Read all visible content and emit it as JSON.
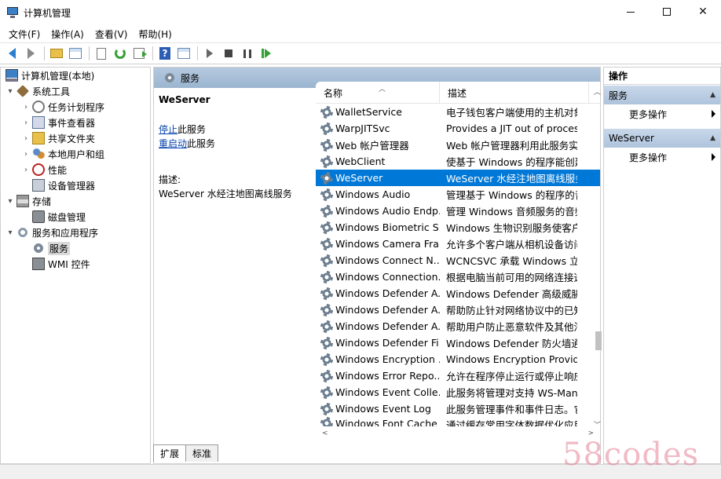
{
  "window": {
    "title": "计算机管理",
    "controls": {
      "minimize": "—",
      "maximize": "☐",
      "close": "✕"
    }
  },
  "menu": [
    "文件(F)",
    "操作(A)",
    "查看(V)",
    "帮助(H)"
  ],
  "toolbar": {
    "icons": [
      "back-icon",
      "forward-icon",
      "up-folder-icon",
      "show-hide-tree-icon",
      "properties-icon",
      "refresh-icon",
      "export-list-icon",
      "help-icon",
      "show-hide-action-pane-icon",
      "start-service-icon",
      "stop-service-icon",
      "pause-service-icon",
      "restart-service-icon"
    ]
  },
  "tree": {
    "root": "计算机管理(本地)",
    "items": [
      {
        "label": "系统工具",
        "level": 1,
        "expanded": true
      },
      {
        "label": "任务计划程序",
        "level": 2,
        "has_children": true
      },
      {
        "label": "事件查看器",
        "level": 2,
        "has_children": true
      },
      {
        "label": "共享文件夹",
        "level": 2,
        "has_children": true
      },
      {
        "label": "本地用户和组",
        "level": 2,
        "has_children": true
      },
      {
        "label": "性能",
        "level": 2,
        "has_children": true
      },
      {
        "label": "设备管理器",
        "level": 2,
        "has_children": false
      },
      {
        "label": "存储",
        "level": 1,
        "expanded": true
      },
      {
        "label": "磁盘管理",
        "level": 2,
        "has_children": false
      },
      {
        "label": "服务和应用程序",
        "level": 1,
        "expanded": true
      },
      {
        "label": "服务",
        "level": 2,
        "selected": true
      },
      {
        "label": "WMI 控件",
        "level": 2
      }
    ]
  },
  "middle": {
    "header": "服务",
    "details": {
      "service_name": "WeServer",
      "stop_link": "停止",
      "stop_suffix": "此服务",
      "restart_link": "重启动",
      "restart_suffix": "此服务",
      "desc_label": "描述:",
      "desc_text": "WeServer 水经注地图离线服务"
    },
    "columns": {
      "name": "名称",
      "desc": "描述"
    },
    "rows": [
      {
        "name": "WalletService",
        "desc": "电子钱包客户端使用的主机对象"
      },
      {
        "name": "WarpJITSvc",
        "desc": "Provides a JIT out of process"
      },
      {
        "name": "Web 帐户管理器",
        "desc": "Web 帐户管理器利用此服务实现"
      },
      {
        "name": "WebClient",
        "desc": "使基于 Windows 的程序能创建、"
      },
      {
        "name": "WeServer",
        "desc": "WeServer 水经注地图离线服务",
        "selected": true
      },
      {
        "name": "Windows Audio",
        "desc": "管理基于 Windows 的程序的音频"
      },
      {
        "name": "Windows Audio Endp...",
        "desc": "管理 Windows 音频服务的音频设"
      },
      {
        "name": "Windows Biometric S...",
        "desc": "Windows 生物识别服务使客户端"
      },
      {
        "name": "Windows Camera Fra...",
        "desc": "允许多个客户端从相机设备访问视"
      },
      {
        "name": "Windows Connect N...",
        "desc": "WCNCSVC 承载 Windows 立即连"
      },
      {
        "name": "Windows Connection...",
        "desc": "根据电脑当前可用的网络连接选项"
      },
      {
        "name": "Windows Defender A...",
        "desc": "Windows Defender 高级威胁防护"
      },
      {
        "name": "Windows Defender A...",
        "desc": "帮助防止针对网络协议中的已知和"
      },
      {
        "name": "Windows Defender A...",
        "desc": "帮助用户防止恶意软件及其他潜在"
      },
      {
        "name": "Windows Defender Fi...",
        "desc": "Windows Defender 防火墙通过阻"
      },
      {
        "name": "Windows Encryption ...",
        "desc": "Windows Encryption Provider Ho"
      },
      {
        "name": "Windows Error Repo...",
        "desc": "允许在程序停止运行或停止响应时"
      },
      {
        "name": "Windows Event Colle...",
        "desc": "此服务将管理对支持 WS-Manage"
      },
      {
        "name": "Windows Event Log",
        "desc": "此服务管理事件和事件日志。它支"
      },
      {
        "name": "Windows Font Cache ...",
        "desc": "通过缓存常用字体数据优化应用程"
      }
    ],
    "tabs": [
      "扩展",
      "标准"
    ]
  },
  "actions": {
    "title": "操作",
    "sections": [
      {
        "title": "服务",
        "items": [
          "更多操作"
        ]
      },
      {
        "title": "WeServer",
        "items": [
          "更多操作"
        ]
      }
    ]
  },
  "watermark": "58codes"
}
